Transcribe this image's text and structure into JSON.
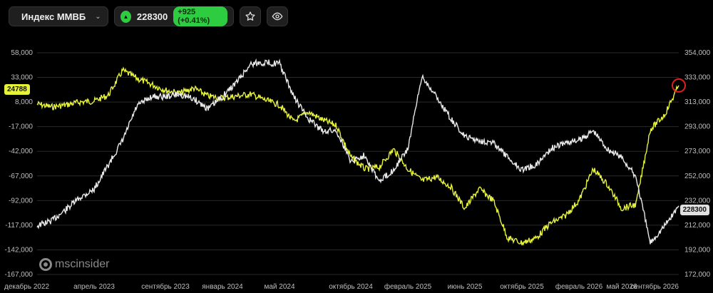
{
  "header": {
    "index_name": "Индекс ММВБ",
    "price": "228300",
    "change": "+925 (+0.41%)"
  },
  "logo_text": "mscinsider",
  "markers": {
    "left_value": "24788",
    "right_value": "228300"
  },
  "colors": {
    "left_series": "#e6f23a",
    "right_series": "#e8e8e8",
    "accent_up": "#2ecc40",
    "highlight_circle": "#e01f1f"
  },
  "chart_data": {
    "type": "line",
    "title": "",
    "xlabel": "",
    "ylabel": "",
    "x_ticks": [
      "декабрь 2022",
      "апрель 2023",
      "сентябрь 2023",
      "январь 2024",
      "май 2024",
      "октябрь 2024",
      "февраль 2025",
      "июнь 2025",
      "октябрь 2025",
      "февраль 2026",
      "май 2026",
      "сентябрь 2026"
    ],
    "y_left_ticks": [
      "58,000",
      "33,000",
      "8,000",
      "-17,000",
      "-42,000",
      "-67,000",
      "-92,000",
      "-117,000",
      "-142,000",
      "-167,000"
    ],
    "y_right_ticks": [
      "354,000",
      "333,000",
      "313,000",
      "293,000",
      "273,000",
      "252,000",
      "232,000",
      "212,000",
      "192,000",
      "172,000"
    ],
    "y_left_range": [
      -167000,
      58000
    ],
    "y_right_range": [
      172000,
      354000
    ],
    "series": [
      {
        "axis": "left",
        "x": [
          "2022-12",
          "2023-01",
          "2023-02",
          "2023-03",
          "2023-04",
          "2023-05",
          "2023-06",
          "2023-07",
          "2023-08",
          "2023-09",
          "2023-10",
          "2023-11",
          "2023-12",
          "2024-01",
          "2024-02",
          "2024-03",
          "2024-04",
          "2024-05",
          "2024-06",
          "2024-07",
          "2024-08",
          "2024-09",
          "2024-10",
          "2024-11",
          "2024-12",
          "2025-01",
          "2025-02",
          "2025-03",
          "2025-04",
          "2025-05",
          "2025-06",
          "2025-07",
          "2025-08",
          "2025-09",
          "2025-10",
          "2025-11",
          "2025-12",
          "2026-01",
          "2026-02",
          "2026-03",
          "2026-04",
          "2026-05",
          "2026-06",
          "2026-07",
          "2026-08",
          "2026-09"
        ],
        "y": [
          6000,
          3000,
          5000,
          8000,
          9000,
          15000,
          40000,
          32000,
          26000,
          20000,
          17000,
          22000,
          14000,
          12000,
          14000,
          16000,
          10000,
          5000,
          -12000,
          -2000,
          -10000,
          -16000,
          -48000,
          -60000,
          -58000,
          -40000,
          -60000,
          -72000,
          -68000,
          -78000,
          -100000,
          -80000,
          -92000,
          -130000,
          -135000,
          -130000,
          -115000,
          -108000,
          -92000,
          -60000,
          -76000,
          -100000,
          -96000,
          -20000,
          -5000,
          24788
        ]
      },
      {
        "axis": "right",
        "x": [
          "2022-12",
          "2023-01",
          "2023-02",
          "2023-03",
          "2023-04",
          "2023-05",
          "2023-06",
          "2023-07",
          "2023-08",
          "2023-09",
          "2023-10",
          "2023-11",
          "2023-12",
          "2024-01",
          "2024-02",
          "2024-03",
          "2024-04",
          "2024-05",
          "2024-06",
          "2024-07",
          "2024-08",
          "2024-09",
          "2024-10",
          "2024-11",
          "2024-12",
          "2025-01",
          "2025-02",
          "2025-03",
          "2025-04",
          "2025-05",
          "2025-06",
          "2025-07",
          "2025-08",
          "2025-09",
          "2025-10",
          "2025-11",
          "2025-12",
          "2026-01",
          "2026-02",
          "2026-03",
          "2026-04",
          "2026-05",
          "2026-06",
          "2026-07",
          "2026-08",
          "2026-09"
        ],
        "y": [
          212000,
          216000,
          225000,
          235000,
          242000,
          262000,
          282000,
          310000,
          318000,
          318000,
          320000,
          316000,
          308000,
          318000,
          330000,
          345000,
          346000,
          345000,
          318000,
          300000,
          290000,
          290000,
          265000,
          270000,
          248000,
          258000,
          275000,
          335000,
          318000,
          300000,
          285000,
          282000,
          280000,
          268000,
          258000,
          262000,
          275000,
          280000,
          282000,
          290000,
          275000,
          268000,
          252000,
          198000,
          212000,
          228300
        ]
      }
    ]
  }
}
